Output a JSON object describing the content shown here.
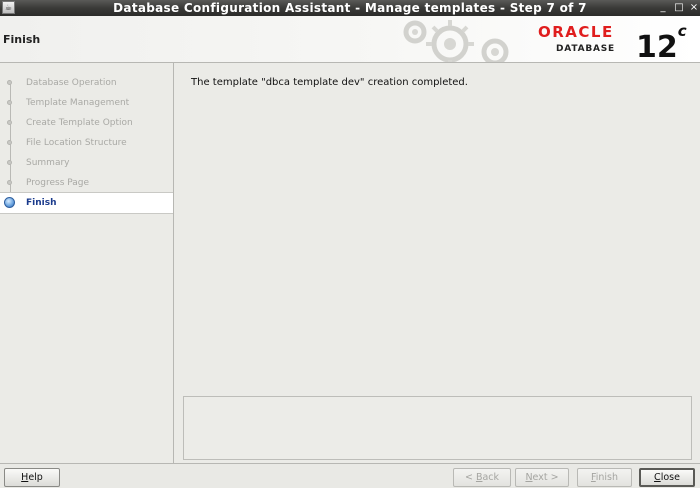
{
  "window": {
    "title": "Database Configuration Assistant - Manage templates - Step 7 of 7",
    "controls": {
      "minimize": "_",
      "maximize": "□",
      "close": "×"
    }
  },
  "header": {
    "page_title": "Finish",
    "logo": {
      "brand": "ORACLE",
      "product": "DATABASE",
      "version": "12",
      "version_suffix": "c"
    }
  },
  "steps": {
    "items": [
      {
        "label": "Database Operation",
        "state": "completed"
      },
      {
        "label": "Template Management",
        "state": "completed"
      },
      {
        "label": "Create Template Option",
        "state": "completed"
      },
      {
        "label": "File Location Structure",
        "state": "completed"
      },
      {
        "label": "Summary",
        "state": "completed"
      },
      {
        "label": "Progress Page",
        "state": "completed"
      },
      {
        "label": "Finish",
        "state": "active"
      }
    ]
  },
  "main": {
    "message": "The template \"dbca template dev\" creation completed."
  },
  "buttons": {
    "help": {
      "pre": "",
      "mnemonic": "H",
      "post": "elp",
      "enabled": true
    },
    "back": {
      "pre": "< ",
      "mnemonic": "B",
      "post": "ack",
      "enabled": false
    },
    "next": {
      "pre": "",
      "mnemonic": "N",
      "post": "ext >",
      "enabled": false
    },
    "finish": {
      "pre": "",
      "mnemonic": "F",
      "post": "inish",
      "enabled": false
    },
    "close": {
      "pre": "",
      "mnemonic": "C",
      "post": "lose",
      "enabled": true
    }
  },
  "colors": {
    "active_step_text": "#1a3a8c",
    "oracle_red": "#e01d1d",
    "titlebar": "#3a3a38"
  }
}
